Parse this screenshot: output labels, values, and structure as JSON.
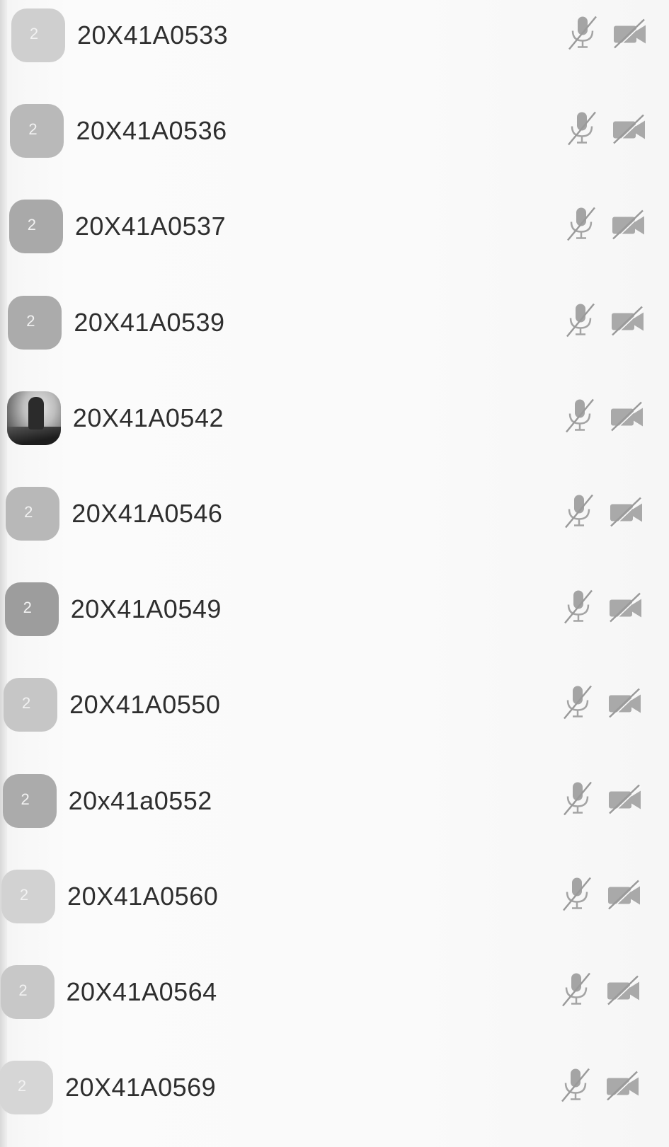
{
  "participants": [
    {
      "name": "20X41A0533",
      "initial": "2",
      "avatar": "initial",
      "avatar_color": "#cfcfcf",
      "mic_muted": true,
      "video_off": true
    },
    {
      "name": "20X41A0536",
      "initial": "2",
      "avatar": "initial",
      "avatar_color": "#b9b9b9",
      "mic_muted": true,
      "video_off": true
    },
    {
      "name": "20X41A0537",
      "initial": "2",
      "avatar": "initial",
      "avatar_color": "#a9a9a9",
      "mic_muted": true,
      "video_off": true
    },
    {
      "name": "20X41A0539",
      "initial": "2",
      "avatar": "initial",
      "avatar_color": "#ababab",
      "mic_muted": true,
      "video_off": true
    },
    {
      "name": "20X41A0542",
      "initial": "",
      "avatar": "photo",
      "avatar_color": "#6e6e6e",
      "mic_muted": true,
      "video_off": true
    },
    {
      "name": "20X41A0546",
      "initial": "2",
      "avatar": "initial",
      "avatar_color": "#b8b8b8",
      "mic_muted": true,
      "video_off": true
    },
    {
      "name": "20X41A0549",
      "initial": "2",
      "avatar": "initial",
      "avatar_color": "#9d9d9d",
      "mic_muted": true,
      "video_off": true
    },
    {
      "name": "20X41A0550",
      "initial": "2",
      "avatar": "initial",
      "avatar_color": "#c6c6c6",
      "mic_muted": true,
      "video_off": true
    },
    {
      "name": "20x41a0552",
      "initial": "2",
      "avatar": "initial",
      "avatar_color": "#ababab",
      "mic_muted": true,
      "video_off": true
    },
    {
      "name": "20X41A0560",
      "initial": "2",
      "avatar": "initial",
      "avatar_color": "#d2d2d2",
      "mic_muted": true,
      "video_off": true
    },
    {
      "name": "20X41A0564",
      "initial": "2",
      "avatar": "initial",
      "avatar_color": "#c8c8c8",
      "mic_muted": true,
      "video_off": true
    },
    {
      "name": "20X41A0569",
      "initial": "2",
      "avatar": "initial",
      "avatar_color": "#d6d6d6",
      "mic_muted": true,
      "video_off": true
    }
  ],
  "icons": {
    "mic": "mic-muted-icon",
    "camera": "video-off-icon"
  },
  "colors": {
    "icon": "#9a9a9a",
    "text": "#2e2e2e"
  }
}
